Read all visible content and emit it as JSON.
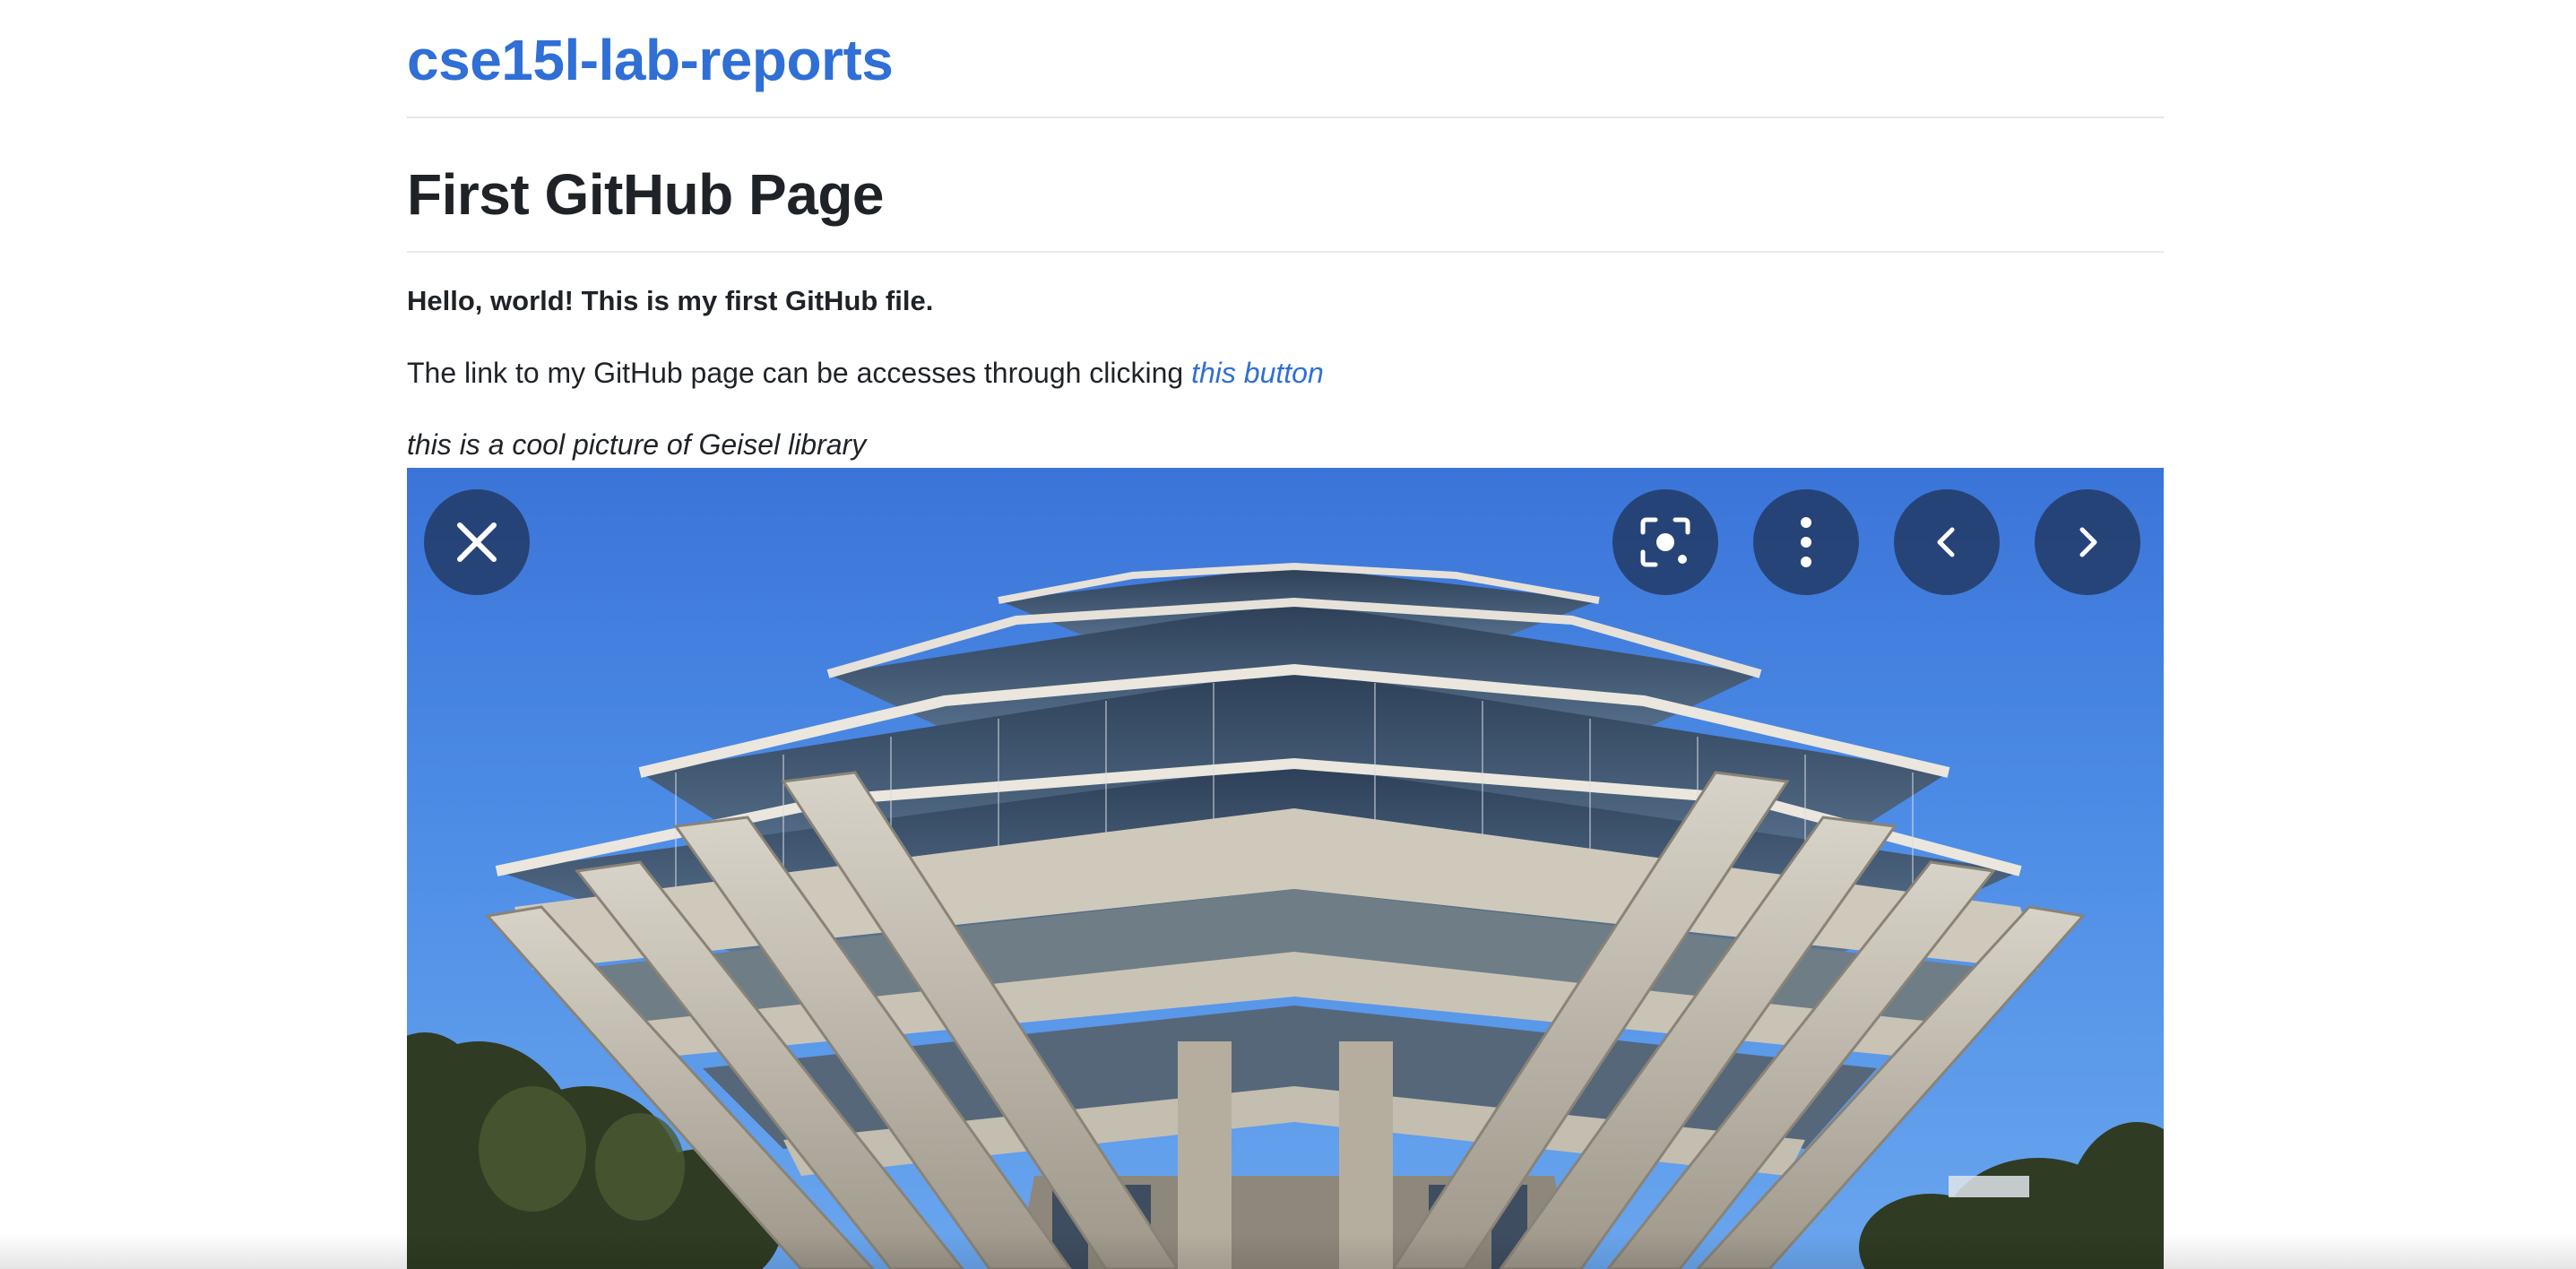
{
  "site": {
    "title": "cse15l-lab-reports"
  },
  "content": {
    "heading": "First GitHub Page",
    "hello_text": "Hello, world! This is my first GitHub file.",
    "link_sentence": "The link to my GitHub page can be accesses through clicking",
    "link_text": "this button",
    "caption": "this is a cool picture of Geisel library"
  },
  "image_viewer": {
    "controls": [
      "close-icon",
      "lens-icon",
      "more-vertical-icon",
      "chevron-left-icon",
      "chevron-right-icon"
    ]
  },
  "colors": {
    "link": "#2f6fd6",
    "text": "#1f2328",
    "sky": "#4d8de6",
    "control_bg": "#20345c"
  }
}
